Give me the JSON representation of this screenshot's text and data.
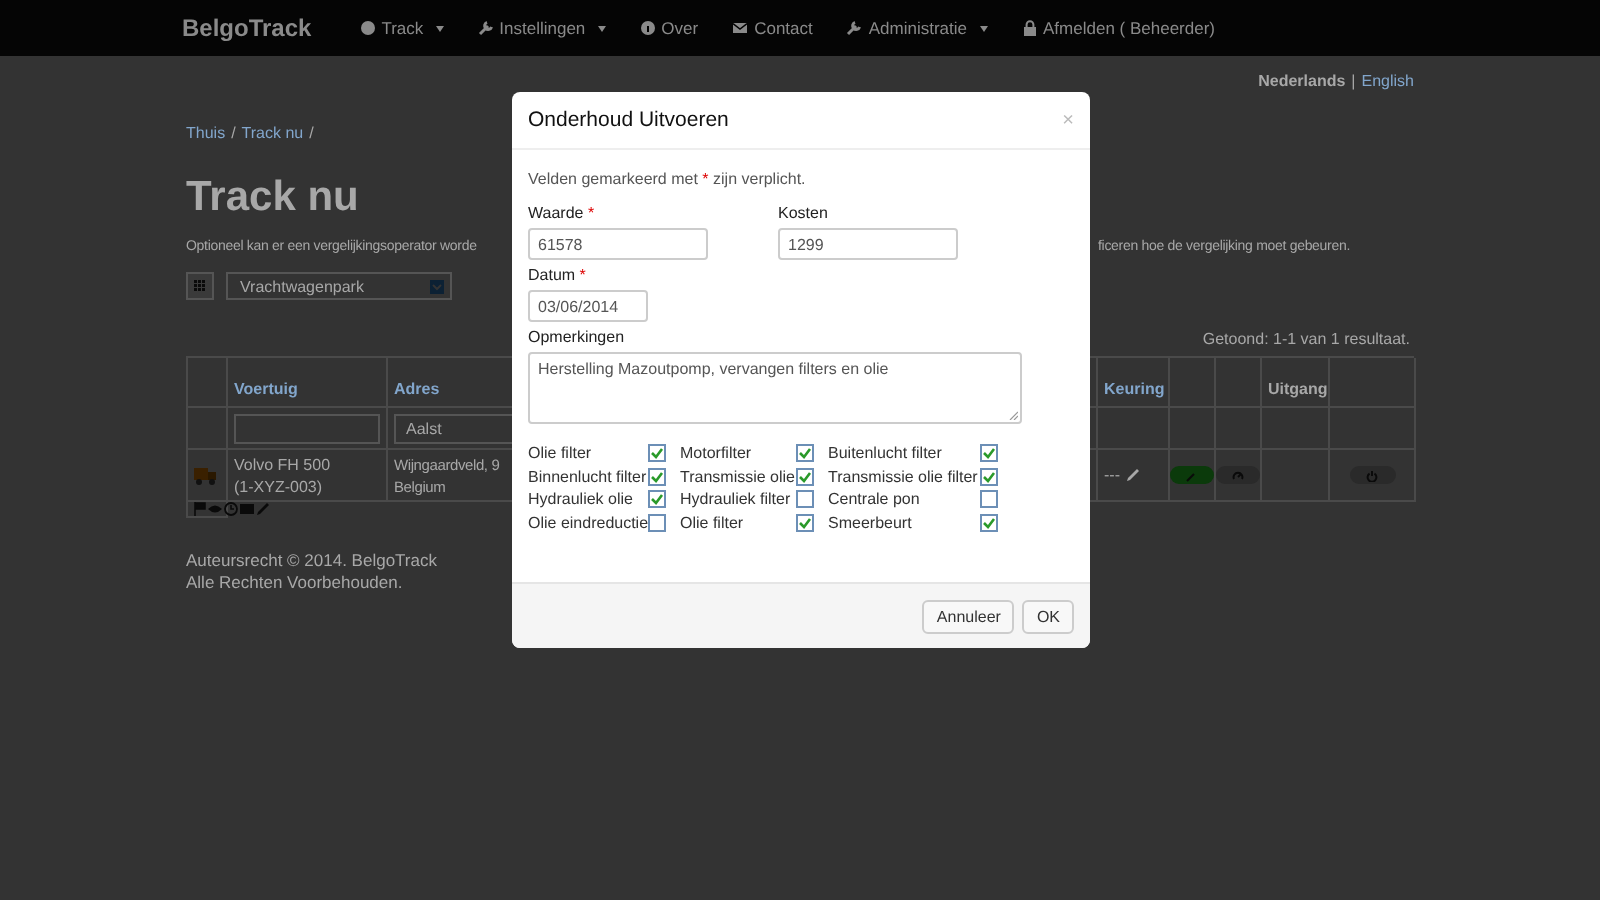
{
  "navbar": {
    "brand": "BelgoTrack",
    "items": [
      {
        "label": "Track",
        "dropdown": true
      },
      {
        "label": "Instellingen",
        "dropdown": true
      },
      {
        "label": "Over",
        "dropdown": false
      },
      {
        "label": "Contact",
        "dropdown": false
      },
      {
        "label": "Administratie",
        "dropdown": true
      },
      {
        "label": "Afmelden ( Beheerder)",
        "dropdown": false
      }
    ]
  },
  "languages": [
    {
      "label": "Nederlands",
      "selected": true
    },
    {
      "label": "English",
      "selected": false
    }
  ],
  "language_separator": "|",
  "breadcrumb": [
    "Thuis",
    "Track nu"
  ],
  "breadcrumb_separator": "/",
  "heading": "Track nu",
  "intro": [
    "Optioneel kan er een vergelijkingsoperator worde",
    "ficeren hoe de vergelijking moet gebeuren."
  ],
  "view_select": {
    "value": "Vrachtwagenpark"
  },
  "summary": "Getoond: 1-1 van 1 resultaat.",
  "table": {
    "columns": [
      {
        "label": "Voertuig",
        "sortable": true
      },
      {
        "label": "Adres",
        "sortable": true,
        "filter_value": "Aalst"
      },
      {
        "label": "Keuring",
        "sortable": true
      },
      {
        "label": "Uitgang",
        "sortable": false
      }
    ],
    "row": {
      "vehicle": "Volvo FH 500",
      "plate": "(1-XYZ-003)",
      "address_lines": [
        "Wijngaardveld, 9",
        "Belgium"
      ],
      "keuring": "---"
    }
  },
  "footer": [
    "Auteursrecht © 2014. BelgoTrack",
    "Alle Rechten Voorbehouden."
  ],
  "modal": {
    "title": "Onderhoud Uitvoeren",
    "close": "×",
    "note": {
      "before": "Velden gemarkeerd met ",
      "mark": "*",
      "after": " zijn verplicht."
    },
    "required_mark": "*",
    "fields": [
      {
        "label": "Waarde",
        "required": true,
        "value": "61578",
        "kind": "input"
      },
      {
        "label": "Kosten",
        "required": false,
        "value": "1299",
        "kind": "input"
      },
      {
        "label": "Datum",
        "required": true,
        "value": "03/06/2014",
        "kind": "date"
      },
      {
        "label": "Opmerkingen",
        "required": false,
        "value": "Herstelling Mazoutpomp, vervangen filters en olie",
        "kind": "textarea"
      }
    ],
    "checks": [
      {
        "label": "Olie filter",
        "checked": true
      },
      {
        "label": "Motorfilter",
        "checked": true
      },
      {
        "label": "Buitenlucht filter",
        "checked": true
      },
      {
        "label": "Binnenlucht filter",
        "checked": true
      },
      {
        "label": "Transmissie olie",
        "checked": true
      },
      {
        "label": "Transmissie olie filter",
        "checked": true
      },
      {
        "label": "Hydrauliek olie",
        "checked": true
      },
      {
        "label": "Hydrauliek filter",
        "checked": false
      },
      {
        "label": "Centrale pon",
        "checked": false
      },
      {
        "label": "Olie eindreductie",
        "checked": false
      },
      {
        "label": "Olie filter",
        "checked": true
      },
      {
        "label": "Smeerbeurt",
        "checked": true
      }
    ],
    "buttons": [
      "Annuleer",
      "OK"
    ]
  }
}
